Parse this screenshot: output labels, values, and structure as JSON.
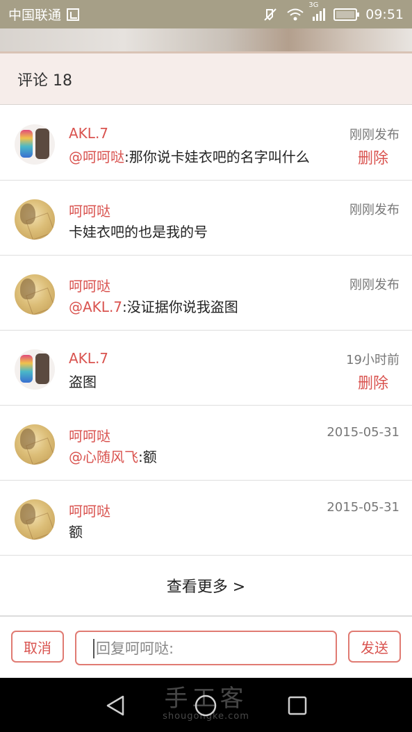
{
  "status_bar": {
    "carrier": "中国联通",
    "network_badge": "3G",
    "time": "09:51",
    "icons": [
      "sim-icon",
      "mute-icon",
      "wifi-icon",
      "signal-icon",
      "battery-icon"
    ]
  },
  "header": {
    "title": "评论 18"
  },
  "comments": [
    {
      "user": "AKL.7",
      "avatar": "avatar-akl",
      "mention": "@呵呵哒",
      "text": ":那你说卡娃衣吧的名字叫什么",
      "time": "刚刚发布",
      "delete_label": "删除"
    },
    {
      "user": "呵呵哒",
      "avatar": "avatar-hehe",
      "mention": "",
      "text": "卡娃衣吧的也是我的号",
      "time": "刚刚发布",
      "delete_label": ""
    },
    {
      "user": "呵呵哒",
      "avatar": "avatar-hehe",
      "mention": "@AKL.7",
      "text": ":没证据你说我盗图",
      "time": "刚刚发布",
      "delete_label": ""
    },
    {
      "user": "AKL.7",
      "avatar": "avatar-akl",
      "mention": "",
      "text": "盗图",
      "time": "19小时前",
      "delete_label": "删除"
    },
    {
      "user": "呵呵哒",
      "avatar": "avatar-hehe",
      "mention": "@心随风飞",
      "text": ":额",
      "time": "2015-05-31",
      "delete_label": ""
    },
    {
      "user": "呵呵哒",
      "avatar": "avatar-hehe",
      "mention": "",
      "text": "额",
      "time": "2015-05-31",
      "delete_label": ""
    }
  ],
  "view_more": "查看更多 >",
  "reply_bar": {
    "cancel_label": "取消",
    "placeholder": "回复呵呵哒:",
    "send_label": "发送"
  },
  "watermark": {
    "title": "手工客",
    "url": "shougongke.com"
  },
  "colors": {
    "status_bar": "#a69f87",
    "accent": "#d9534f",
    "header_bg": "#f6edea",
    "nav_bar": "#000000"
  }
}
